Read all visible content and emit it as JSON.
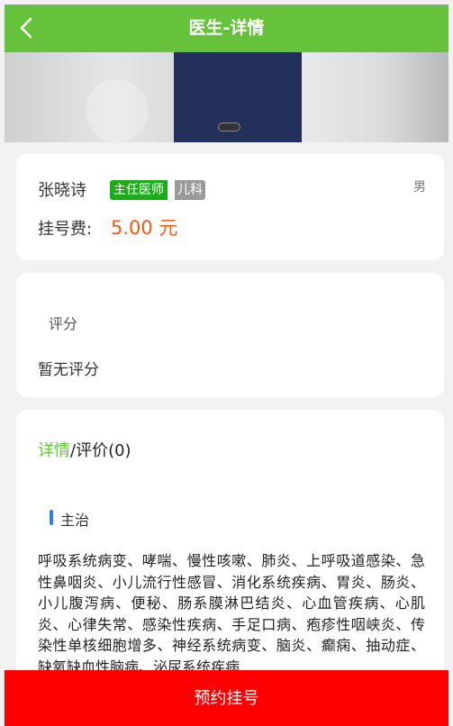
{
  "header": {
    "title": "医生-详情",
    "back_icon": "chevron-left-icon",
    "color": "#66c23a"
  },
  "banner": {
    "carousel_indicator": "slide-dot"
  },
  "doctor": {
    "name": "张晓诗",
    "title_badge": "主任医师",
    "department_badge": "儿科",
    "gender": "男",
    "fee_label": "挂号费:",
    "fee_value": "5.00 元"
  },
  "rating": {
    "label": "评分",
    "value": "暂无评分"
  },
  "detail": {
    "tab_active": "详情",
    "tab_separator": "/",
    "tab_inactive": "评价(0)",
    "section_title": "主治",
    "text": "呼吸系统病变、哮喘、慢性咳嗽、肺炎、上呼吸道感染、急性鼻咽炎、小儿流行性感冒、消化系统疾病、胃炎、肠炎、小儿腹泻病、便秘、肠系膜淋巴结炎、心血管疾病、心肌炎、心律失常、感染性疾病、手足口病、疱疹性咽峡炎、传染性单核细胞增多、神经系统病变、脑炎、癫痫、抽动症、缺氧缺血性脑病、泌尿系统疾病"
  },
  "footer": {
    "book_button": "预约挂号",
    "color": "#ff0000"
  }
}
